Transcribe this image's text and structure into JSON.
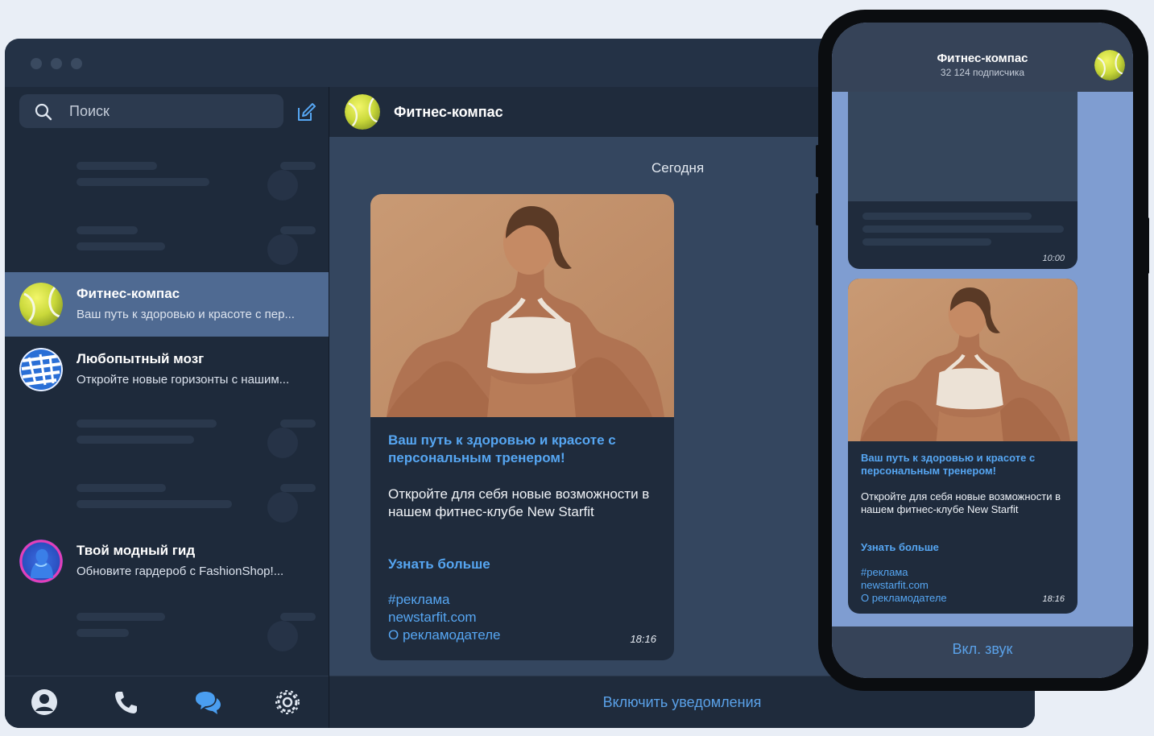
{
  "sidebar": {
    "search_placeholder": "Поиск",
    "chats": [
      {
        "name": "Фитнес-компас",
        "preview": "Ваш путь к здоровью и красоте с пер...",
        "active": true
      },
      {
        "name": "Любопытный мозг",
        "preview": "Откройте новые горизонты с нашим...",
        "active": false
      },
      {
        "name": "Твой модный гид",
        "preview": "Обновите гардероб с FashionShop!...",
        "active": false
      }
    ],
    "nav": [
      "profile-icon",
      "phone-icon",
      "chats-icon",
      "settings-icon"
    ]
  },
  "chat": {
    "title": "Фитнес-компас",
    "date_divider": "Сегодня",
    "message": {
      "headline": "Ваш путь к здоровью и красоте с персональным тренером!",
      "body": "Откройте для себя новые возможности в нашем фитнес-клубе New Starfit",
      "cta": "Узнать больше",
      "hashtag": "#реклама",
      "site": "newstarfit.com",
      "about": "О рекламодателе",
      "time": "18:16"
    },
    "bottom_button": "Включить уведомления"
  },
  "phone": {
    "title": "Фитнес-компас",
    "subscribers": "32 124 подписчика",
    "prev_time": "10:00",
    "message": {
      "headline": "Ваш путь к здоровью и красоте с персональным тренером!",
      "body": "Откройте для себя новые возможности в нашем фитнес-клубе New Starfit",
      "cta": "Узнать больше",
      "hashtag": "#реклама",
      "site": "newstarfit.com",
      "about": "О рекламодателе",
      "time": "18:16"
    },
    "bottom_button": "Вкл. звук"
  },
  "colors": {
    "accent": "#56a6f2",
    "active_chat": "#4f6a92",
    "panel": "#1f2b3c"
  }
}
